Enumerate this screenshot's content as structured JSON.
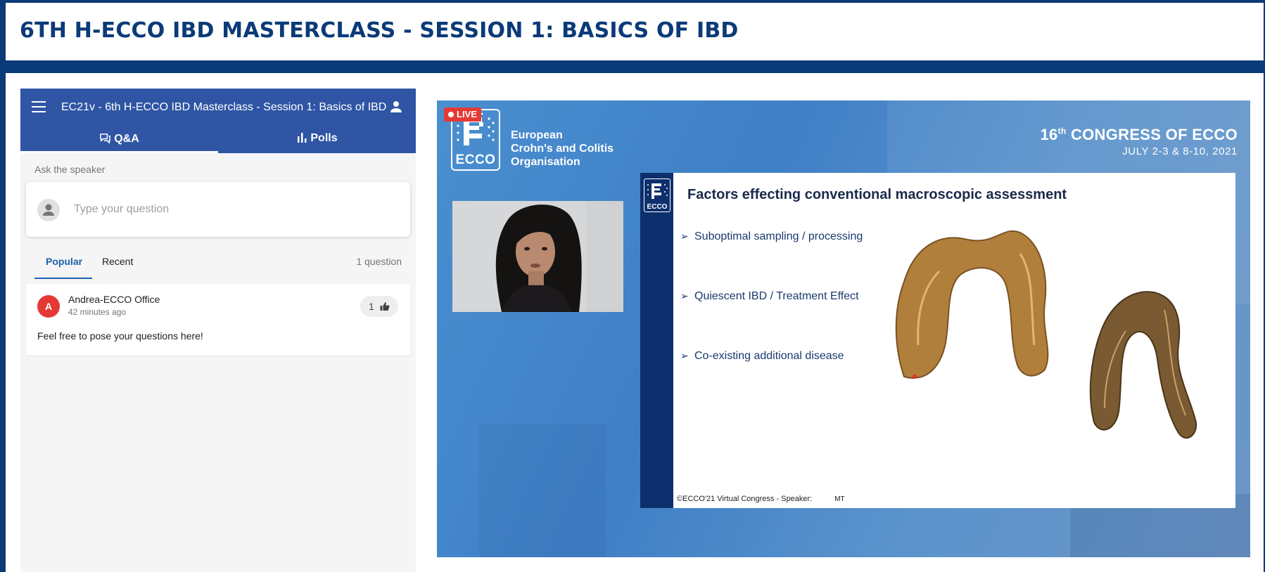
{
  "page": {
    "title": "6TH H-ECCO IBD MASTERCLASS - SESSION 1: BASICS OF IBD"
  },
  "qa_panel": {
    "event_title": "EC21v - 6th H-ECCO IBD Masterclass - Session 1: Basics of IBD",
    "tabs": [
      {
        "label": "Q&A",
        "icon": "comments-icon",
        "active": true
      },
      {
        "label": "Polls",
        "icon": "bar-chart-icon",
        "active": false
      }
    ],
    "ask_label": "Ask the speaker",
    "question_placeholder": "Type your question",
    "sort_tabs": [
      "Popular",
      "Recent"
    ],
    "question_count": "1 question",
    "questions": [
      {
        "avatar_letter": "A",
        "author": "Andrea-ECCO Office",
        "time": "42 minutes ago",
        "likes": "1",
        "text": "Feel free to pose your questions here!"
      }
    ],
    "colors": {
      "header": "#2f55a4",
      "accent": "#1f5fae",
      "avatar": "#e53935"
    }
  },
  "video": {
    "live_label": "LIVE",
    "logo_text": "ECCO",
    "org_lines": [
      "European",
      "Crohn's and Colitis",
      "Organisation"
    ],
    "congress_num": "16",
    "congress_sup": "th",
    "congress_title": " CONGRESS OF ECCO",
    "congress_dates": "JULY 2-3 & 8-10, 2021",
    "slide": {
      "logo_text": "ECCO",
      "title": "Factors effecting conventional macroscopic assessment",
      "bullets": [
        "Suboptimal sampling / processing",
        "Quiescent IBD / Treatment Effect",
        "Co-existing additional disease"
      ],
      "footer": "©ECCO'21 Virtual Congress -  Speaker:",
      "speaker_initials": "MT"
    }
  }
}
